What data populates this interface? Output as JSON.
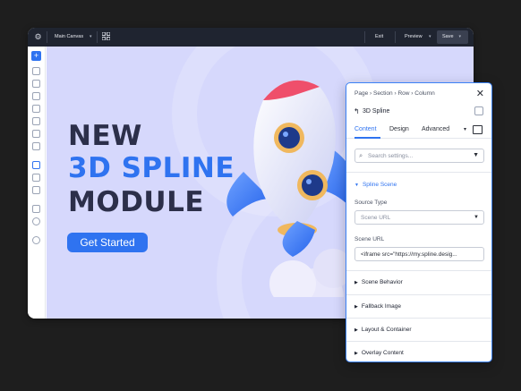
{
  "topbar": {
    "logo_icon": "gear-icon",
    "canvas_name": "Main Canvas",
    "grid_icon": "grid-icon",
    "exit_label": "Exit",
    "preview_label": "Preview",
    "save_label": "Save"
  },
  "hero": {
    "line1": "NEW",
    "line2": "3D SPLINE",
    "line3": "MODULE",
    "cta": "Get Started"
  },
  "panel": {
    "breadcrumb": [
      "Page",
      "Section",
      "Row",
      "Column"
    ],
    "title": "3D Spline",
    "tabs": [
      "Content",
      "Design",
      "Advanced"
    ],
    "search_placeholder": "Search settings...",
    "open_section": "Spline Scene",
    "source_type_label": "Source Type",
    "source_type_value": "Scene URL",
    "scene_url_label": "Scene URL",
    "scene_url_value": "<iframe src=\"https://my.spline.desig...",
    "collapsed_sections": [
      "Scene Behavior",
      "Fallback Image",
      "Layout & Container",
      "Overlay Content"
    ]
  },
  "colors": {
    "accent": "#2f73f0",
    "canvas_bg": "#d6d8fc",
    "heading_dark": "#2c2f4a",
    "topbar": "#1f2430"
  }
}
